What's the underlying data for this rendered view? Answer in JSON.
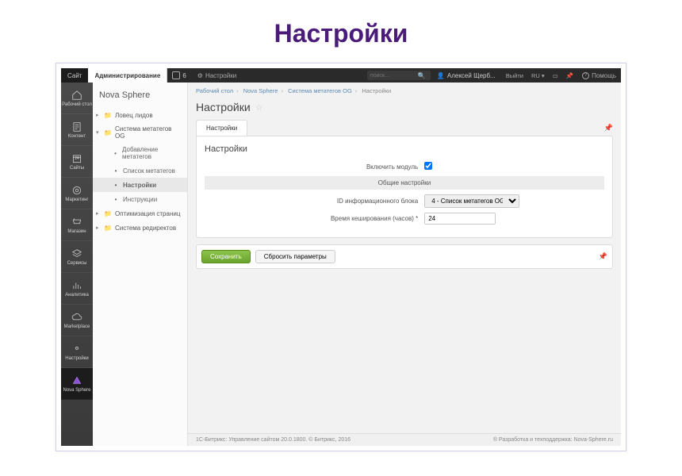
{
  "outer_title": "Настройки",
  "topbar": {
    "site": "Сайт",
    "admin": "Администрирование",
    "updates_count": "6",
    "settings_link": "Настройки",
    "search_placeholder": "поиск...",
    "user": "Алексей Щерб...",
    "logout": "Выйти",
    "lang": "RU",
    "help": "Помощь"
  },
  "leftbar": [
    {
      "label": "Рабочий стол",
      "icon": "home"
    },
    {
      "label": "Контент",
      "icon": "doc"
    },
    {
      "label": "Сайты",
      "icon": "calendar"
    },
    {
      "label": "Маркетинг",
      "icon": "target"
    },
    {
      "label": "Магазин",
      "icon": "cart"
    },
    {
      "label": "Сервисы",
      "icon": "stack"
    },
    {
      "label": "Аналитика",
      "icon": "chart"
    },
    {
      "label": "Marketplace",
      "icon": "cloud"
    },
    {
      "label": "Настройки",
      "icon": "gear"
    },
    {
      "label": "Nova Sphere",
      "icon": "logo",
      "active": true
    }
  ],
  "brand": "Nova Sphere",
  "tree": {
    "n0": "Ловец лидов",
    "n1": "Система метатегов OG",
    "n1_0": "Добавление метатегов",
    "n1_1": "Список метатегов",
    "n1_2": "Настройки",
    "n1_3": "Инструкции",
    "n2": "Оптимизация страниц",
    "n3": "Система редиректов"
  },
  "crumbs": {
    "c0": "Рабочий стол",
    "c1": "Nova Sphere",
    "c2": "Система метатегов OG",
    "c3": "Настройки"
  },
  "page_heading": "Настройки",
  "tab_label": "Настройки",
  "panel_title": "Настройки",
  "form": {
    "enable_label": "Включить модуль",
    "enable_checked": true,
    "section_common": "Общие настройки",
    "iblock_label": "ID информационного блока",
    "iblock_value": "4 - Список метатегов OG",
    "cache_label": "Время кеширования (часов) *",
    "cache_value": "24"
  },
  "buttons": {
    "save": "Сохранить",
    "reset": "Сбросить параметры"
  },
  "footer": {
    "left": "1С-Битрикс: Управление сайтом 20.0.1800. © Битрикс, 2016",
    "right": "® Разработка и техподдержка: Nova-Sphere.ru"
  }
}
